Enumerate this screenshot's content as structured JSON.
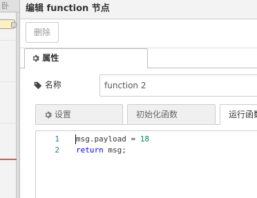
{
  "workspace": {
    "tab_label": "卧"
  },
  "tray": {
    "title": "编辑 function 节点",
    "delete_label": "删除"
  },
  "tabs": {
    "properties_label": "属性"
  },
  "form": {
    "name_label": "名称",
    "name_value": "function 2"
  },
  "subtabs": [
    {
      "label": "设置"
    },
    {
      "label": "初始化函数"
    },
    {
      "label": "运行函数"
    }
  ],
  "editor": {
    "lines": [
      {
        "number": "1",
        "tokens": [
          {
            "text": "msg.payload = ",
            "cls": ""
          },
          {
            "text": "18",
            "cls": "num"
          }
        ]
      },
      {
        "number": "2",
        "tokens": [
          {
            "text": "return",
            "cls": "kw"
          },
          {
            "text": " msg;",
            "cls": ""
          }
        ]
      }
    ]
  },
  "colors": {
    "keyword": "#0000ff",
    "number": "#098658",
    "line_number": "#237893",
    "flow_line": "#d9534f"
  },
  "icons": [
    "gear-icon",
    "tag-icon"
  ]
}
